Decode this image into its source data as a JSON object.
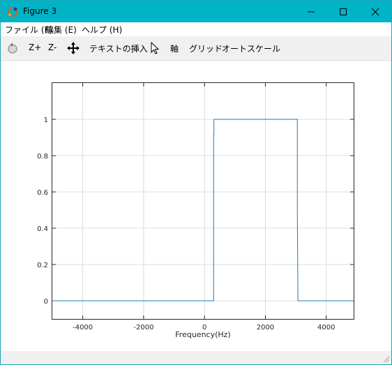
{
  "window": {
    "title": "Figure 3",
    "minimize_glyph": "—",
    "maximize_glyph": "☐",
    "close_glyph": "✕",
    "accent_color": "#00b4c8"
  },
  "menu": {
    "items": [
      {
        "label": "ファイル (F)"
      },
      {
        "label": "編集 (E)"
      },
      {
        "label": "ヘルプ (H)"
      }
    ]
  },
  "toolbar": {
    "reset_icon": "reset-zoom-icon",
    "zoom_in_label": "Z+",
    "zoom_out_label": "Z-",
    "pan_icon": "pan-arrows-icon",
    "insert_text_label": "テキストの挿入",
    "select_icon": "cursor-arrow-icon",
    "axis_label": "軸",
    "grid_label": "グリッド",
    "autoscale_label": "オートスケール"
  },
  "chart_data": {
    "type": "line",
    "title": "",
    "xlabel": "Frequency(Hz)",
    "ylabel": "",
    "xlim": [
      -5000,
      4900
    ],
    "ylim": [
      -0.1,
      1.2
    ],
    "xticks": [
      -4000,
      -2000,
      0,
      2000,
      4000
    ],
    "xtick_labels": [
      "-4000",
      "-2000",
      "0",
      "2000",
      "4000"
    ],
    "yticks": [
      0,
      0.2,
      0.4,
      0.6,
      0.8,
      1
    ],
    "ytick_labels": [
      "0",
      "0.2",
      "0.4",
      "0.6",
      "0.8",
      "1"
    ],
    "grid": true,
    "series": [
      {
        "color": "#1f77b4",
        "x": [
          -5000,
          300,
          300,
          310,
          310,
          3050,
          3050,
          3070,
          4900
        ],
        "y": [
          0,
          0,
          0.92,
          0.92,
          1,
          1,
          0.5,
          0,
          0
        ]
      }
    ]
  }
}
